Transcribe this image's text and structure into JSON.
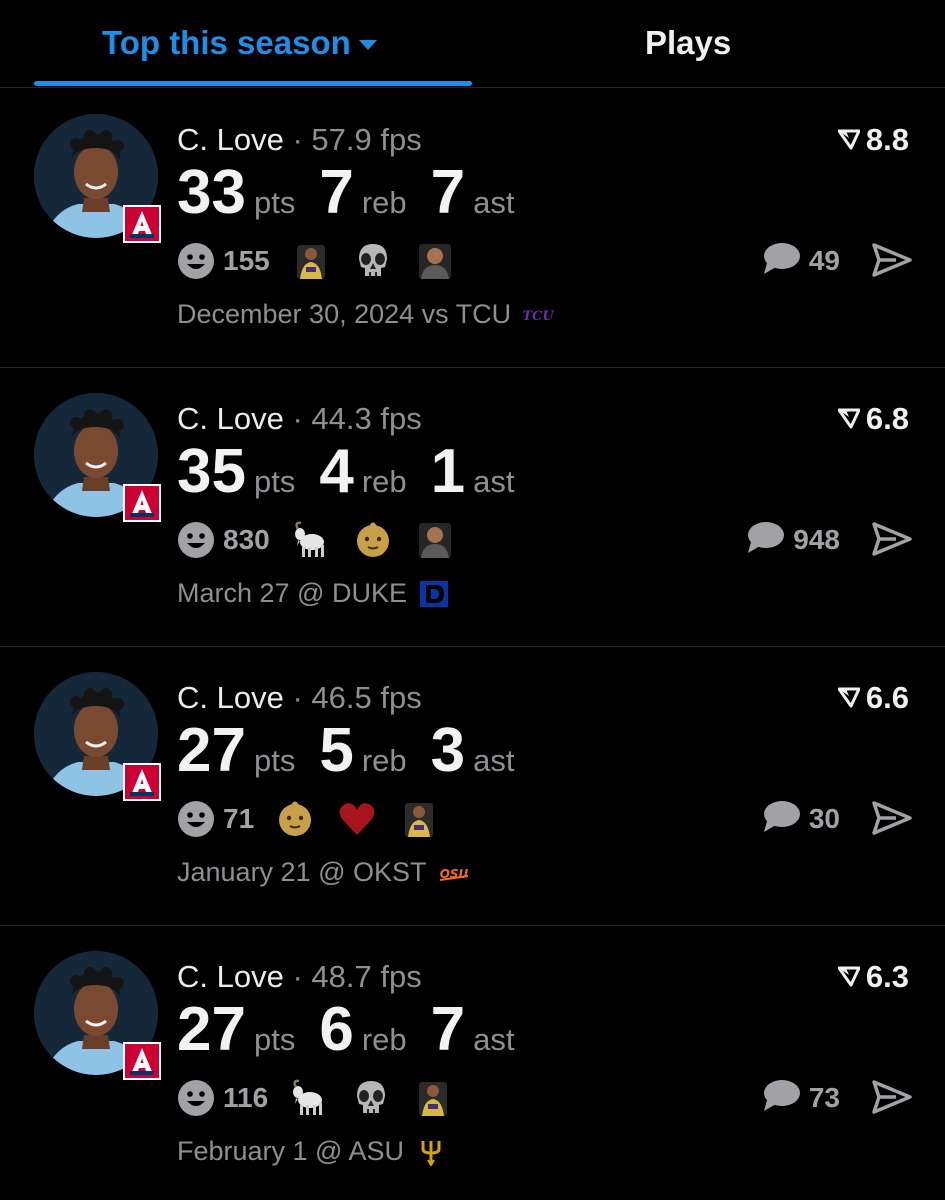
{
  "tabs": {
    "season_label": "Top this season",
    "plays_label": "Plays"
  },
  "colors": {
    "accent": "#1d8fe8",
    "background": "#000000",
    "muted": "#8e8e93"
  },
  "icons": {
    "rating": "filter-funnel-icon",
    "reaction": "smiley-icon",
    "comment": "comment-bubble-icon",
    "share": "paper-plane-icon"
  },
  "cards": [
    {
      "name": "C. Love",
      "fps": "· 57.9 fps",
      "rating": "8.8",
      "pts": "33",
      "pts_label": "pts",
      "reb": "7",
      "reb_label": "reb",
      "ast": "7",
      "ast_label": "ast",
      "reactions": "155",
      "comments": "49",
      "emojis": [
        "player-photo-emoji",
        "skull-emoji",
        "person-photo-emoji"
      ],
      "date": "December 30, 2024 vs TCU",
      "opponent_logo": "tcu-logo"
    },
    {
      "name": "C. Love",
      "fps": "· 44.3 fps",
      "rating": "6.8",
      "pts": "35",
      "pts_label": "pts",
      "reb": "4",
      "reb_label": "reb",
      "ast": "1",
      "ast_label": "ast",
      "reactions": "830",
      "comments": "948",
      "emojis": [
        "goat-emoji",
        "baby-emoji",
        "person-photo-emoji"
      ],
      "date": "March 27 @ DUKE",
      "opponent_logo": "duke-logo"
    },
    {
      "name": "C. Love",
      "fps": "· 46.5 fps",
      "rating": "6.6",
      "pts": "27",
      "pts_label": "pts",
      "reb": "5",
      "reb_label": "reb",
      "ast": "3",
      "ast_label": "ast",
      "reactions": "71",
      "comments": "30",
      "emojis": [
        "baby-emoji",
        "heart-emoji",
        "player-photo-emoji"
      ],
      "date": "January 21 @ OKST",
      "opponent_logo": "okstate-logo"
    },
    {
      "name": "C. Love",
      "fps": "· 48.7 fps",
      "rating": "6.3",
      "pts": "27",
      "pts_label": "pts",
      "reb": "6",
      "reb_label": "reb",
      "ast": "7",
      "ast_label": "ast",
      "reactions": "116",
      "comments": "73",
      "emojis": [
        "goat-emoji",
        "skull-emoji",
        "player-photo-emoji"
      ],
      "date": "February 1 @ ASU",
      "opponent_logo": "asu-pitchfork-logo"
    }
  ]
}
